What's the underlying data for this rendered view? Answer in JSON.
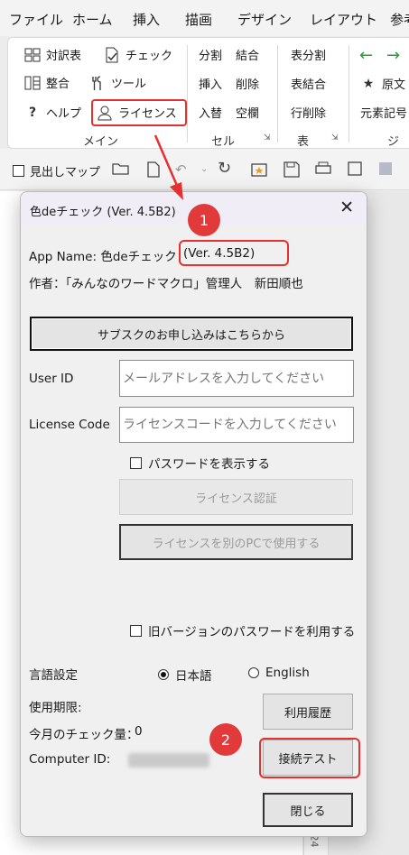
{
  "menubar": {
    "items": [
      "ファイル",
      "ホーム",
      "挿入",
      "描画",
      "デザイン",
      "レイアウト",
      "参考"
    ]
  },
  "ribbon": {
    "main_group": {
      "items": [
        "対訳表",
        "チェック",
        "整合",
        "ツール",
        "ヘルプ",
        "ライセンス"
      ],
      "label": "メイン"
    },
    "cell_group": {
      "items": [
        "分割",
        "結合",
        "挿入",
        "削除",
        "入替",
        "空欄"
      ],
      "label": "セル"
    },
    "table_group": {
      "items": [
        "表分割",
        "表結合",
        "行削除"
      ],
      "label": "表"
    },
    "right_group": {
      "items": [
        "原文",
        "元素記号"
      ],
      "label": "ジャ"
    }
  },
  "qat": {
    "navigation_pane_label": "見出しマップ"
  },
  "background": {
    "page_number": "24"
  },
  "dialog": {
    "title": "色deチェック (Ver. 4.5B2)",
    "app_name_label": "App Name: 色deチェック",
    "version": "(Ver. 4.5B2)",
    "author": "作者：「みんなのワードマクロ」管理人　新田順也",
    "subscribe_button": "サブスクのお申し込みはこちらから",
    "user_id_label": "User ID",
    "user_id_placeholder": "メールアドレスを入力してください",
    "license_code_label": "License Code",
    "license_code_placeholder": "ライセンスコードを入力してください",
    "show_password_label": "パスワードを表示する",
    "license_auth_button": "ライセンス認証",
    "use_other_pc_button": "ライセンスを別のPCで使用する",
    "old_password_label": "旧バージョンのパスワードを利用する",
    "language_label": "言語設定",
    "language_options": [
      "日本語",
      "English"
    ],
    "language_selected": "日本語",
    "expiry_label": "使用期限:",
    "checks_label": "今月のチェック量：",
    "checks_value": "0",
    "computer_id_label": "Computer ID:",
    "history_button": "利用履歴",
    "connection_test_button": "接続テスト",
    "close_button": "閉じる"
  },
  "annotations": {
    "badge1": "1",
    "badge2": "2",
    "color": "#e53030"
  }
}
